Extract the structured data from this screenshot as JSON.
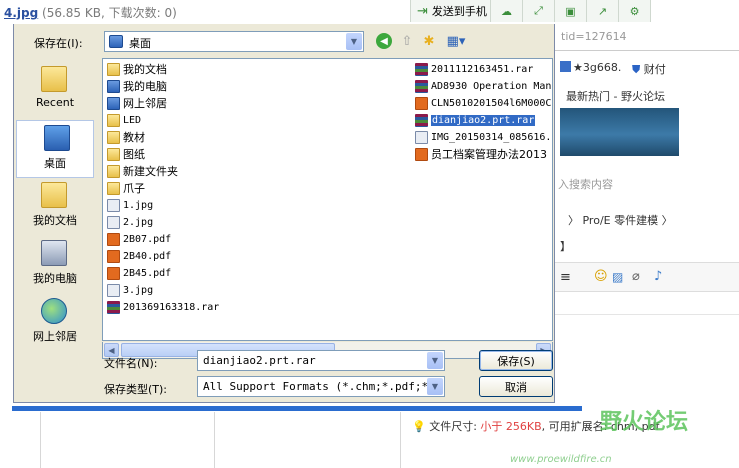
{
  "background_page": {
    "file_link": "4.jpg",
    "file_info": " (56.85 KB, 下载次数: 0)",
    "send_to_phone": "发送到手机",
    "tid_text": "tid=127614",
    "user_text": "★3g668.",
    "wealth_text": "财付",
    "hot_text": "最新热门 - 野火论坛",
    "search_placeholder": "入搜索内容",
    "breadcrumb": "〉 Pro/E 零件建模 〉",
    "bracket": "】",
    "filesize_hint_label": "文件尺寸: ",
    "filesize_hint_value": "小于 256KB",
    "filesize_hint_rest": ", 可用扩展名: chm, pdf",
    "watermark_title": "野火论坛",
    "watermark_url": "www.proewildfire.cn"
  },
  "dialog": {
    "save_in_label": "保存在(I):",
    "save_in_value": "桌面",
    "places": [
      {
        "label": "Recent",
        "icon": "recent-folder-icon"
      },
      {
        "label": "桌面",
        "icon": "desktop-icon"
      },
      {
        "label": "我的文档",
        "icon": "my-documents-icon"
      },
      {
        "label": "我的电脑",
        "icon": "my-computer-icon"
      },
      {
        "label": "网上邻居",
        "icon": "network-icon"
      }
    ],
    "files_col1": [
      {
        "name": "我的文档",
        "type": "folder"
      },
      {
        "name": "我的电脑",
        "type": "sys"
      },
      {
        "name": "网上邻居",
        "type": "sys"
      },
      {
        "name": "LED",
        "type": "folder"
      },
      {
        "name": "教材",
        "type": "folder"
      },
      {
        "name": "图纸",
        "type": "folder"
      },
      {
        "name": "新建文件夹",
        "type": "folder"
      },
      {
        "name": "爪子",
        "type": "folder"
      },
      {
        "name": "1.jpg",
        "type": "jpg"
      },
      {
        "name": "2.jpg",
        "type": "jpg"
      },
      {
        "name": "2B07.pdf",
        "type": "pdf"
      },
      {
        "name": "2B40.pdf",
        "type": "pdf"
      },
      {
        "name": "2B45.pdf",
        "type": "pdf"
      },
      {
        "name": "3.jpg",
        "type": "jpg"
      },
      {
        "name": "201369163318.rar",
        "type": "rar"
      }
    ],
    "files_col2": [
      {
        "name": "2011112163451.rar",
        "type": "rar"
      },
      {
        "name": "AD8930 Operation Man",
        "type": "rar"
      },
      {
        "name": "CLN5010201504l6M000C",
        "type": "pdf"
      },
      {
        "name": "dianjiao2.prt.rar",
        "type": "rar",
        "selected": true
      },
      {
        "name": "IMG_20150314_085616.",
        "type": "jpg"
      },
      {
        "name": "员工档案管理办法2013",
        "type": "pdf"
      }
    ],
    "filename_label": "文件名(N):",
    "filename_value": "dianjiao2.prt.rar",
    "filetype_label": "保存类型(T):",
    "filetype_value": "All Support Formats (*.chm;*.pdf;*.zi",
    "save_button": "保存(S)",
    "cancel_button": "取消"
  }
}
